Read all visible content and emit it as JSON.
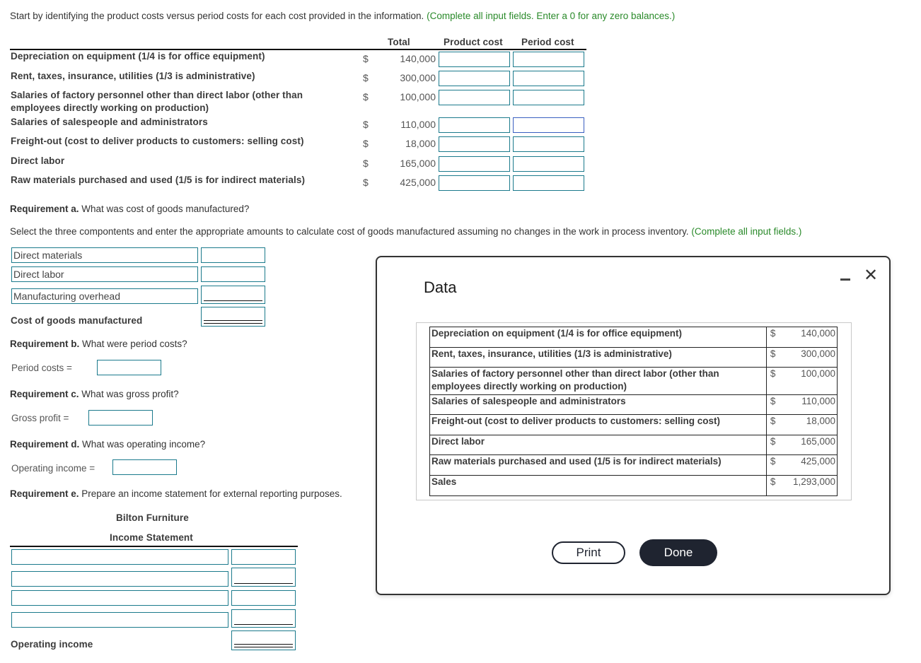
{
  "instructions": {
    "main": "Start by identifying the product costs versus period costs for each cost provided in the information.",
    "note": "(Complete all input fields. Enter a 0 for any zero balances.)"
  },
  "cost_table": {
    "headers": {
      "total": "Total",
      "product": "Product cost",
      "period": "Period cost"
    },
    "currency": "$",
    "rows": [
      {
        "label": "Depreciation on equipment (1/4 is for office equipment)",
        "label2": "",
        "total": "140,000",
        "product": "",
        "period": ""
      },
      {
        "label": "Rent, taxes, insurance, utilities (1/3 is administrative)",
        "label2": "",
        "total": "300,000",
        "product": "",
        "period": ""
      },
      {
        "label": "Salaries of factory personnel other than direct labor (other than",
        "label2": "employees directly working on production)",
        "total": "100,000",
        "product": "",
        "period": ""
      },
      {
        "label": "Salaries of salespeople and administrators",
        "label2": "",
        "total": "110,000",
        "product": "",
        "period": ""
      },
      {
        "label": "Freight-out (cost to deliver products to customers: selling cost)",
        "label2": "",
        "total": "18,000",
        "product": "",
        "period": ""
      },
      {
        "label": "Direct labor",
        "label2": "",
        "total": "165,000",
        "product": "",
        "period": ""
      },
      {
        "label": "Raw materials purchased and used (1/5 is for indirect materials)",
        "label2": "",
        "total": "425,000",
        "product": "",
        "period": ""
      }
    ]
  },
  "req_a": {
    "title": "Requirement a.",
    "question": "What was cost of goods manufactured?",
    "instruction": "Select the three compontents and enter the appropriate amounts to calculate cost of goods manufactured assuming no changes in the work in process inventory.",
    "note": "(Complete all input fields.)",
    "components": [
      {
        "selected": "Direct materials",
        "amount": ""
      },
      {
        "selected": "Direct labor",
        "amount": ""
      },
      {
        "selected": "Manufacturing overhead",
        "amount": ""
      }
    ],
    "total_label": "Cost of goods manufactured",
    "total_amount": ""
  },
  "req_b": {
    "title": "Requirement b.",
    "question": "What were period costs?",
    "label": "Period costs =",
    "value": ""
  },
  "req_c": {
    "title": "Requirement c.",
    "question": "What was gross profit?",
    "label": "Gross profit =",
    "value": ""
  },
  "req_d": {
    "title": "Requirement d.",
    "question": "What was operating income?",
    "label": "Operating income =",
    "value": ""
  },
  "req_e": {
    "title": "Requirement e.",
    "question": "Prepare an income statement for external reporting purposes.",
    "company": "Bilton Furniture",
    "statement": "Income Statement",
    "rows": [
      {
        "label": "",
        "amount": ""
      },
      {
        "label": "",
        "amount": ""
      },
      {
        "label": "",
        "amount": ""
      },
      {
        "label": "",
        "amount": ""
      }
    ],
    "total_label": "Operating income",
    "total_amount": ""
  },
  "modal": {
    "title": "Data",
    "minimize_icon": "minimize-icon",
    "close_icon": "close-icon",
    "close_glyph": "✕",
    "currency": "$",
    "rows": [
      {
        "label": "Depreciation on equipment (1/4 is for office equipment)",
        "value": "140,000"
      },
      {
        "label": "Rent, taxes, insurance, utilities (1/3 is administrative)",
        "value": "300,000"
      },
      {
        "label": "Salaries of factory personnel other than direct labor (other than employees directly working on production)",
        "value": "100,000"
      },
      {
        "label": "Salaries of salespeople and administrators",
        "value": "110,000"
      },
      {
        "label": "Freight-out (cost to deliver products to customers: selling cost)",
        "value": "18,000"
      },
      {
        "label": "Direct labor",
        "value": "165,000"
      },
      {
        "label": "Raw materials purchased and used (1/5 is for indirect materials)",
        "value": "425,000"
      },
      {
        "label": "Sales",
        "value": "1,293,000"
      }
    ],
    "print_label": "Print",
    "done_label": "Done"
  }
}
